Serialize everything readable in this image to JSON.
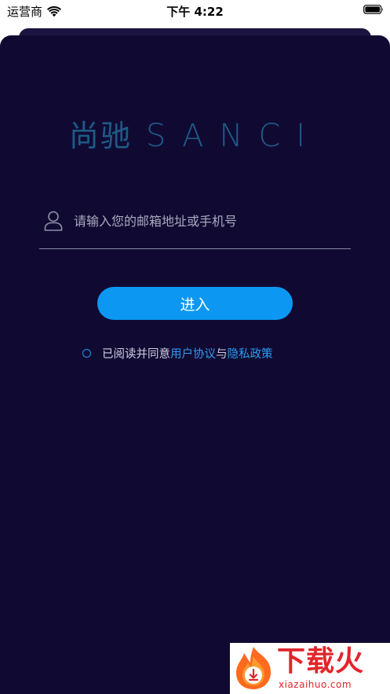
{
  "status_bar": {
    "carrier": "运营商",
    "time": "下午 4:22",
    "wifi_icon": "wifi-icon",
    "battery_icon": "battery-icon"
  },
  "logo": {
    "chinese": "尚驰",
    "english": "SANCI",
    "color": "#1e5a86"
  },
  "login": {
    "user_icon": "user-icon",
    "placeholder": "请输入您的邮箱地址或手机号",
    "value": "",
    "button_label": "进入",
    "button_color": "#0c97f2"
  },
  "agreement": {
    "radio_icon": "radio-unchecked-icon",
    "prefix": "已阅读并同意",
    "user_agreement": "用户协议",
    "joiner": "与",
    "privacy_policy": "隐私政策",
    "link_color": "#2a9cf0"
  },
  "theme": {
    "background": "#100a33"
  },
  "watermark": {
    "logo_icon": "flame-download-icon",
    "title": "下载火",
    "url": "xiazaihuo.com"
  }
}
